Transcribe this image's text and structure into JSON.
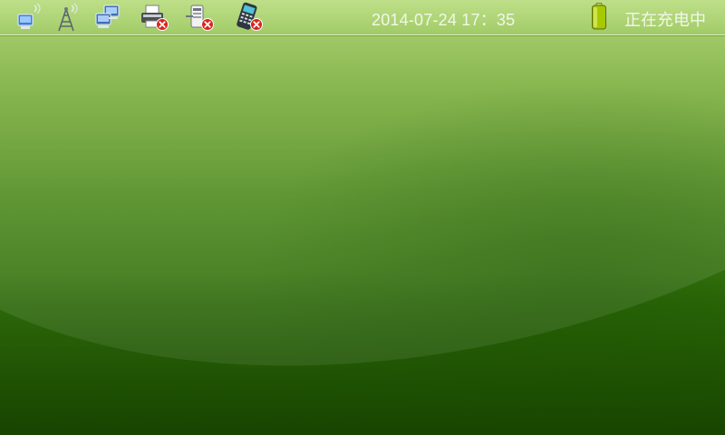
{
  "status_bar": {
    "icons": [
      {
        "name": "network-computer-icon",
        "status": "connected"
      },
      {
        "name": "wireless-tower-icon",
        "status": "connected"
      },
      {
        "name": "lan-computers-icon",
        "status": "connected"
      },
      {
        "name": "printer-icon",
        "status": "error"
      },
      {
        "name": "card-reader-icon",
        "status": "error"
      },
      {
        "name": "pos-terminal-icon",
        "status": "error"
      }
    ],
    "datetime": "2014-07-24 17：35",
    "battery": {
      "status": "charging",
      "color": "#a6c900"
    },
    "charging_text": "正在充电中"
  },
  "colors": {
    "error_badge": "#d9261c",
    "status_text": "#f2f7e9"
  }
}
